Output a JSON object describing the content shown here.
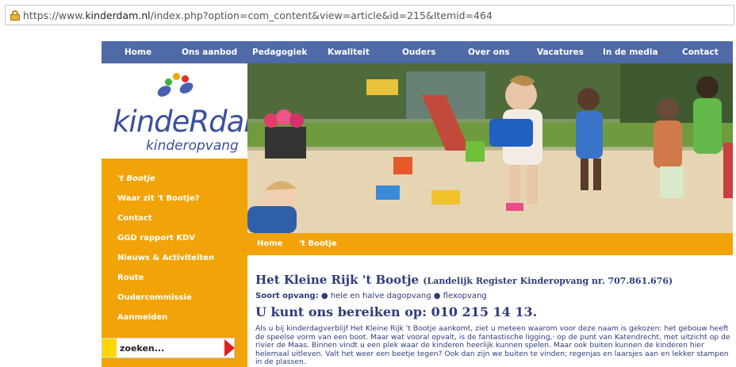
{
  "browser": {
    "url_prefix": "https://www.",
    "url_host": "kinderdam.nl",
    "url_path": "/index.php?option=com_content&view=article&id=215&Itemid=464"
  },
  "topnav": {
    "items": [
      "Home",
      "Ons aanbod",
      "Pedagogiek",
      "Kwaliteit",
      "Ouders",
      "Over ons",
      "Vacatures",
      "In de media",
      "Contact"
    ]
  },
  "logo": {
    "main": "kindeRdam",
    "sub": "kinderopvang"
  },
  "sidebar": {
    "items": [
      "'t Bootje",
      "Waar zit 't Bootje?",
      "Contact",
      "GGD rapport KDV",
      "Nieuws & Activiteiten",
      "Route",
      "Oudercommissie",
      "Aanmelden"
    ],
    "search_value": "zoeken..."
  },
  "breadcrumb": {
    "home": "Home",
    "current": "'t Bootje"
  },
  "article": {
    "title": "Het Kleine Rijk 't Bootje",
    "register": "(Landelijk Register Kinderopvang nr. 707.861.676)",
    "soort_label": "Soort opvang:",
    "soort_value": " ● hele en halve dagopvang ● flexopvang",
    "phone": "U kunt ons bereiken op: 010 215 14 13.",
    "body": "Als u bij kinderdagverblijf Het Kleine Rijk 't Bootje aankomt, ziet u meteen waarom voor deze naam is gekozen: het gebouw heeft de speelse vorm van een boot. Maar wat vooral opvalt, is de fantastische ligging,· op de punt van Katendrecht, met uitzicht op de rivier de Maas. Binnen vindt u een plek waar de kinderen heerlijk kunnen spelen. Maar ook buiten kunnen de kinderen hier helemaal uitleven. Valt het weer een beetje tegen? Ook dan zijn we buiten te vinden; regenjas en laarsjes aan en lekker stampen in de plassen."
  },
  "colors": {
    "nav_blue": "#4f6aa6",
    "orange": "#f2a308",
    "text_navy": "#2f3b7a"
  }
}
